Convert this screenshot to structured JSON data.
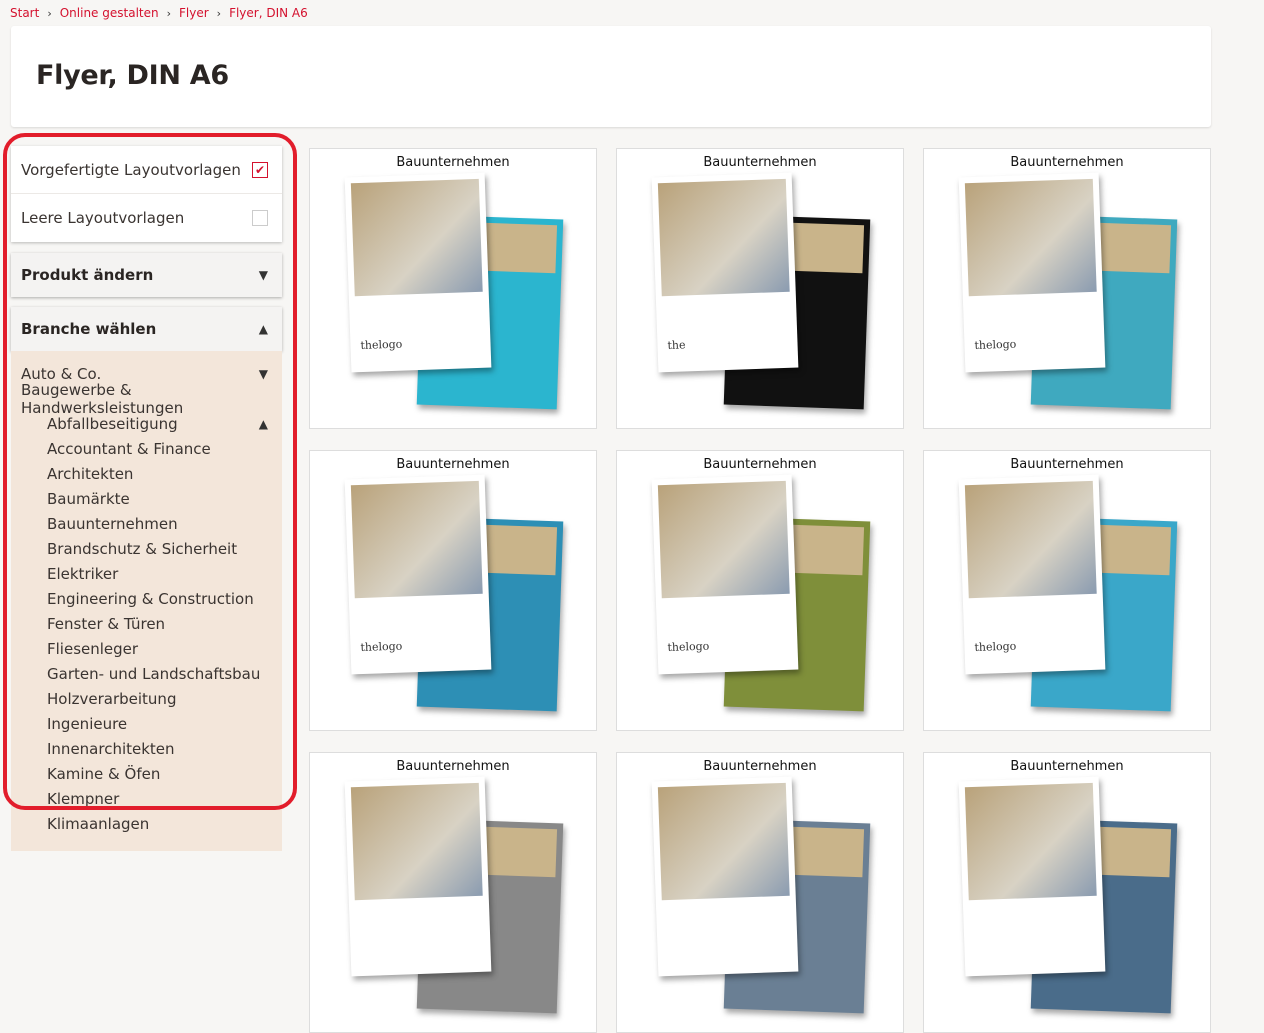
{
  "breadcrumb": [
    "Start",
    "Online gestalten",
    "Flyer",
    "Flyer, DIN A6"
  ],
  "page_title": "Flyer, DIN A6",
  "filters": {
    "prebuilt": {
      "label": "Vorgefertigte Layoutvorlagen",
      "checked": true
    },
    "blank": {
      "label": "Leere Layoutvorlagen",
      "checked": false
    }
  },
  "product_change": {
    "label": "Produkt ändern",
    "icon": "triangle-down-icon"
  },
  "industry": {
    "label": "Branche wählen",
    "icon": "triangle-up-icon",
    "top_items": [
      "Auto & Co.",
      "Baugewerbe & Handwerksleistungen"
    ],
    "sub_items": [
      "Abfallbeseitigung",
      "Accountant & Finance",
      "Architekten",
      "Baumärkte",
      "Bauunternehmen",
      "Brandschutz & Sicherheit",
      "Elektriker",
      "Engineering & Construction",
      "Fenster & Türen",
      "Fliesenleger",
      "Garten- und Landschaftsbau",
      "Holzverarbeitung",
      "Ingenieure",
      "Innenarchitekten",
      "Kamine & Öfen",
      "Klempner",
      "Klimaanlagen"
    ]
  },
  "templates": [
    {
      "title": "Bauunternehmen",
      "accent": "#2bb5cf",
      "logo": "thelogo"
    },
    {
      "title": "Bauunternehmen",
      "accent": "#111111",
      "logo": "the"
    },
    {
      "title": "Bauunternehmen",
      "accent": "#3fa9bf",
      "logo": "thelogo"
    },
    {
      "title": "Bauunternehmen",
      "accent": "#2d8fb5",
      "logo": "thelogo"
    },
    {
      "title": "Bauunternehmen",
      "accent": "#7f8f3a",
      "logo": "thelogo"
    },
    {
      "title": "Bauunternehmen",
      "accent": "#3aa7c9",
      "logo": "thelogo"
    },
    {
      "title": "Bauunternehmen",
      "accent": "#888888",
      "logo": ""
    },
    {
      "title": "Bauunternehmen",
      "accent": "#6a7f94",
      "logo": ""
    },
    {
      "title": "Bauunternehmen",
      "accent": "#4a6c8a",
      "logo": ""
    }
  ],
  "colors": {
    "brand": "#d4112e",
    "highlight_outline": "#e21d2b",
    "list_bg": "#f3e6da"
  }
}
